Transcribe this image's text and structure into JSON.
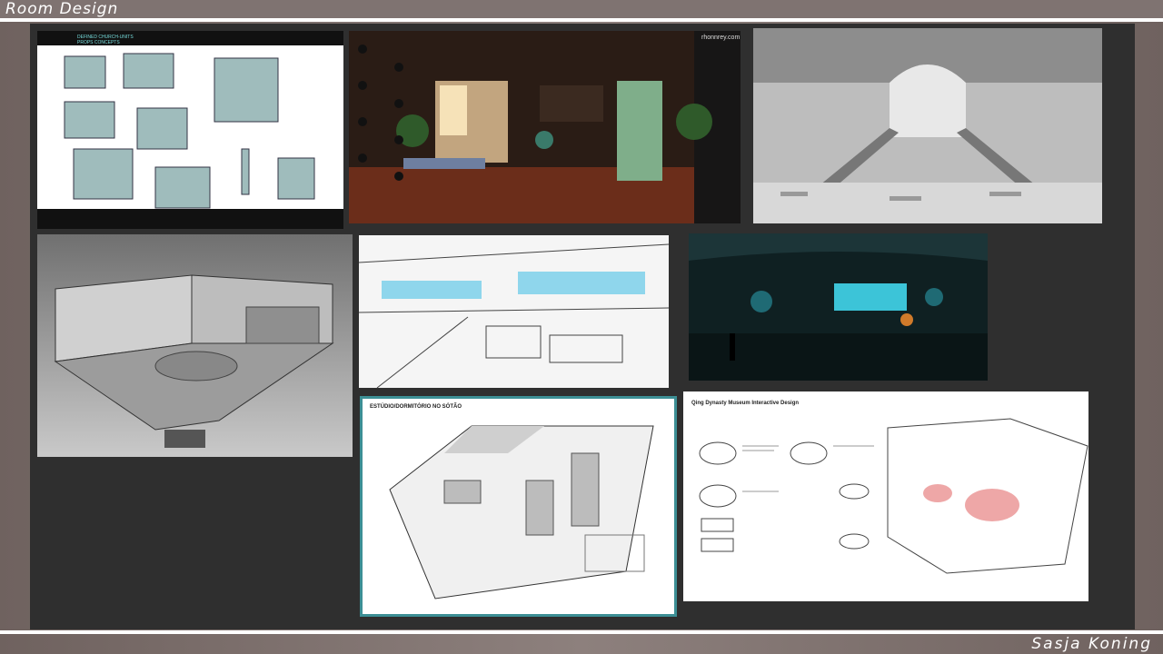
{
  "header": {
    "title": "Room Design"
  },
  "footer": {
    "author": "Sasja Koning"
  },
  "panels": {
    "building_props": {
      "caption": "DEFINED CHURCH-UNITS",
      "subcaption": "PROPS CONCEPTS"
    },
    "kitchen": {
      "watermark": "rhonnrey.com"
    },
    "attic": {
      "heading": "ESTÚDIO/DORMITÓRIO NO SÓTÃO"
    },
    "museum": {
      "heading": "Qing Dynasty Museum Interactive Design"
    }
  },
  "colors": {
    "board": "#2f2f2f",
    "frame": "#8d807d",
    "accent_teal": "#3cc4d8",
    "highlight_red": "#e88a8a"
  }
}
